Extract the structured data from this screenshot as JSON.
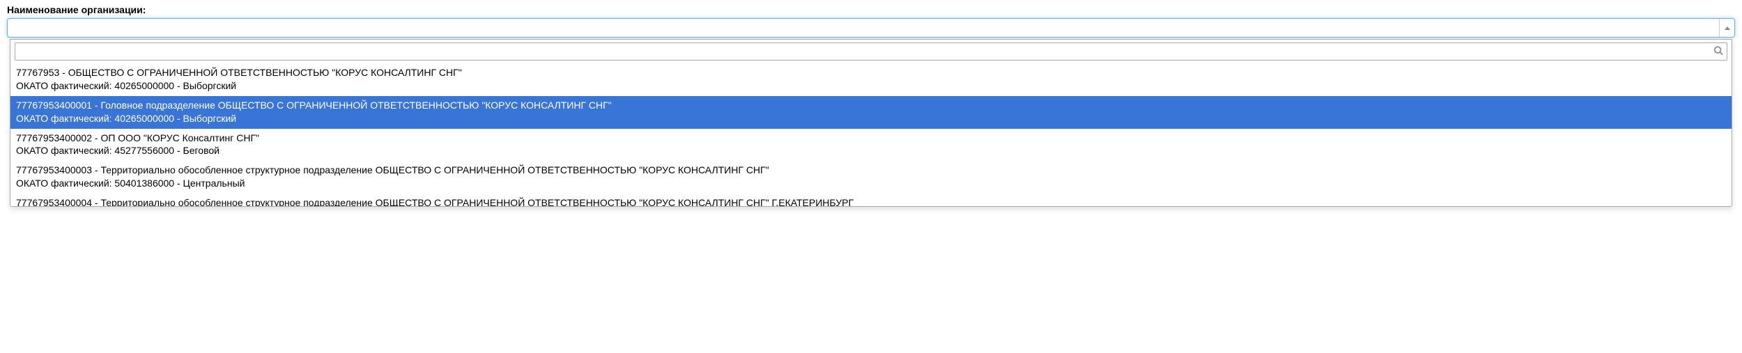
{
  "field": {
    "label": "Наименование организации:",
    "value": ""
  },
  "search": {
    "value": "",
    "placeholder": ""
  },
  "options": [
    {
      "line1": "77767953 - ОБЩЕСТВО С ОГРАНИЧЕННОЙ ОТВЕТСТВЕННОСТЬЮ \"КОРУС КОНСАЛТИНГ СНГ\"",
      "line2": "ОКАТО фактический: 40265000000 - Выборгский",
      "selected": false
    },
    {
      "line1": "77767953400001 - Головное подразделение ОБЩЕСТВО С ОГРАНИЧЕННОЙ ОТВЕТСТВЕННОСТЬЮ \"КОРУС КОНСАЛТИНГ СНГ\"",
      "line2": "ОКАТО фактический: 40265000000 - Выборгский",
      "selected": true
    },
    {
      "line1": "77767953400002 - ОП ООО \"КОРУС Консалтинг СНГ\"",
      "line2": "ОКАТО фактический: 45277556000 - Беговой",
      "selected": false
    },
    {
      "line1": "77767953400003 - Территориально обособленное структурное подразделение ОБЩЕСТВО С ОГРАНИЧЕННОЙ ОТВЕТСТВЕННОСТЬЮ \"КОРУС КОНСАЛТИНГ СНГ\"",
      "line2": "ОКАТО фактический: 50401386000 - Центральный",
      "selected": false
    },
    {
      "line1": "77767953400004 - Территориально обособленное структурное подразделение ОБЩЕСТВО С ОГРАНИЧЕННОЙ ОТВЕТСТВЕННОСТЬЮ \"КОРУС КОНСАЛТИНГ СНГ\" Г.ЕКАТЕРИНБУРГ",
      "line2": "",
      "selected": false,
      "partial": true
    }
  ]
}
